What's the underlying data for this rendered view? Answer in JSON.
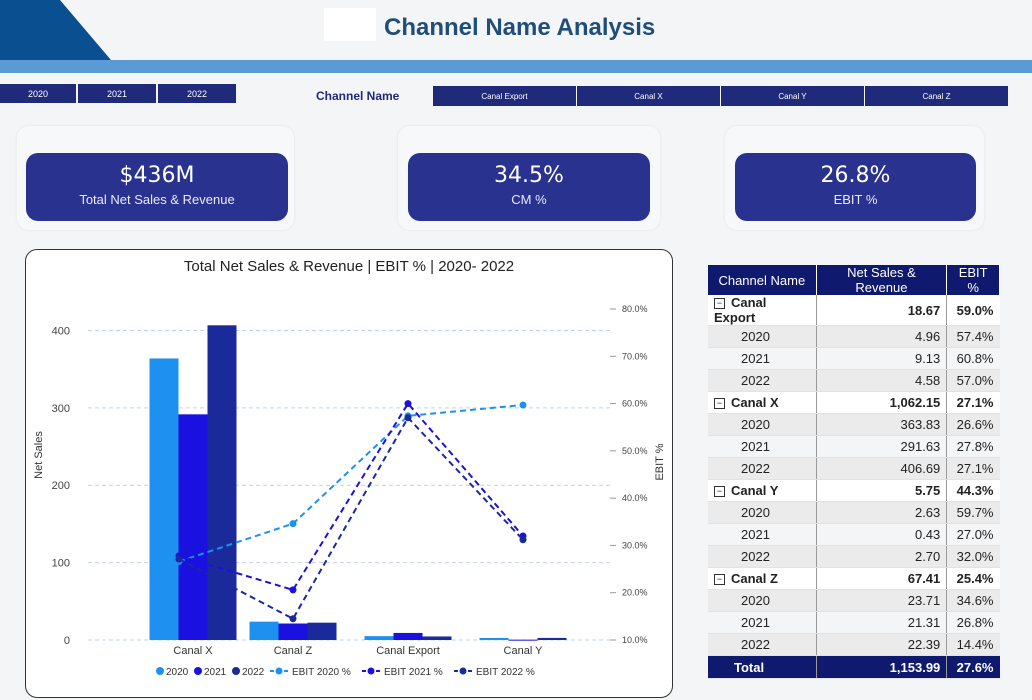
{
  "page": {
    "title": "Channel Name Analysis"
  },
  "year_slicer": [
    "2020",
    "2021",
    "2022"
  ],
  "channel_slicer": {
    "label": "Channel Name",
    "options": [
      "Canal Export",
      "Canal X",
      "Canal Y",
      "Canal Z"
    ]
  },
  "kpis": [
    {
      "value": "$436M",
      "label": "Total Net Sales & Revenue"
    },
    {
      "value": "34.5%",
      "label": "CM %"
    },
    {
      "value": "26.8%",
      "label": "EBIT %"
    }
  ],
  "colors": {
    "navy": "#1f2a7a",
    "kpi": "#29338f",
    "series_2020": "#1e90f0",
    "series_2021": "#1a10e0",
    "series_2022": "#1a2a9a",
    "stripe": "#5b9bd5"
  },
  "chart_data": {
    "type": "bar",
    "title": "Total Net Sales & Revenue | EBIT % | 2020- 2022",
    "categories": [
      "Canal X",
      "Canal Z",
      "Canal Export",
      "Canal Y"
    ],
    "ylabel": "Net Sales",
    "y2label": "EBIT %",
    "ylim": [
      0,
      420
    ],
    "yticks": [
      0,
      100,
      200,
      300,
      400
    ],
    "y2lim": [
      10,
      80
    ],
    "y2ticks": [
      "10.0%",
      "20.0%",
      "30.0%",
      "40.0%",
      "50.0%",
      "60.0%",
      "70.0%",
      "80.0%"
    ],
    "y2tick_values": [
      10,
      20,
      30,
      40,
      50,
      60,
      70,
      80
    ],
    "series": [
      {
        "name": "2020",
        "values": [
          363.83,
          23.71,
          4.96,
          2.63
        ]
      },
      {
        "name": "2021",
        "values": [
          291.63,
          21.31,
          9.13,
          0.43
        ]
      },
      {
        "name": "2022",
        "values": [
          406.69,
          22.39,
          4.58,
          2.7
        ]
      }
    ],
    "line_series": [
      {
        "name": "EBIT 2020 %",
        "values": [
          26.6,
          34.6,
          57.4,
          59.7
        ]
      },
      {
        "name": "EBIT 2021 %",
        "values": [
          27.8,
          20.6,
          60.0,
          32.0
        ]
      },
      {
        "name": "EBIT 2022 %",
        "values": [
          27.1,
          14.5,
          57.0,
          31.2
        ]
      }
    ],
    "legend": [
      "2020",
      "2021",
      "2022",
      "EBIT 2020 %",
      "EBIT 2021 %",
      "EBIT 2022 %"
    ],
    "grid": true,
    "legend_position": "bottom"
  },
  "table": {
    "headers": [
      "Channel Name",
      "Net Sales & Revenue",
      "EBIT %"
    ],
    "groups": [
      {
        "name": "Canal Export",
        "value": "18.67",
        "ebit": "59.0%",
        "rows": [
          {
            "year": "2020",
            "value": "4.96",
            "ebit": "57.4%"
          },
          {
            "year": "2021",
            "value": "9.13",
            "ebit": "60.8%"
          },
          {
            "year": "2022",
            "value": "4.58",
            "ebit": "57.0%"
          }
        ]
      },
      {
        "name": "Canal X",
        "value": "1,062.15",
        "ebit": "27.1%",
        "rows": [
          {
            "year": "2020",
            "value": "363.83",
            "ebit": "26.6%"
          },
          {
            "year": "2021",
            "value": "291.63",
            "ebit": "27.8%"
          },
          {
            "year": "2022",
            "value": "406.69",
            "ebit": "27.1%"
          }
        ]
      },
      {
        "name": "Canal Y",
        "value": "5.75",
        "ebit": "44.3%",
        "rows": [
          {
            "year": "2020",
            "value": "2.63",
            "ebit": "59.7%"
          },
          {
            "year": "2021",
            "value": "0.43",
            "ebit": "27.0%"
          },
          {
            "year": "2022",
            "value": "2.70",
            "ebit": "32.0%"
          }
        ]
      },
      {
        "name": "Canal Z",
        "value": "67.41",
        "ebit": "25.4%",
        "rows": [
          {
            "year": "2020",
            "value": "23.71",
            "ebit": "34.6%"
          },
          {
            "year": "2021",
            "value": "21.31",
            "ebit": "26.8%"
          },
          {
            "year": "2022",
            "value": "22.39",
            "ebit": "14.4%"
          }
        ]
      }
    ],
    "total": {
      "label": "Total",
      "value": "1,153.99",
      "ebit": "27.6%"
    }
  }
}
